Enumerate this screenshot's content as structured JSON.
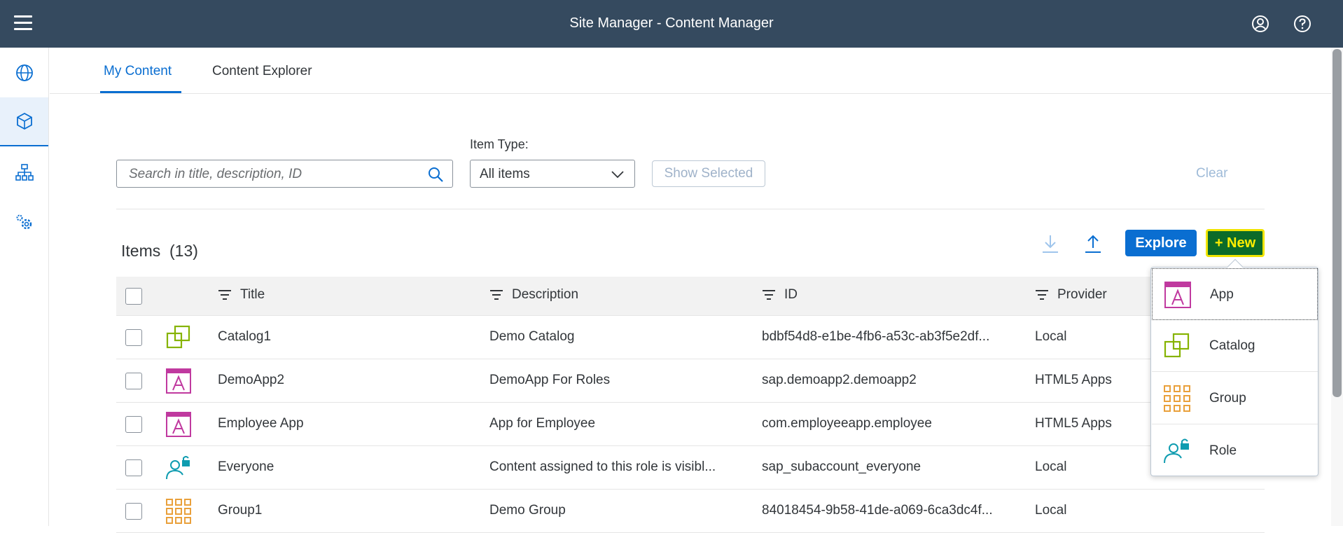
{
  "header": {
    "title": "Site Manager - Content Manager"
  },
  "tabs": [
    {
      "label": "My Content"
    },
    {
      "label": "Content Explorer"
    }
  ],
  "filters": {
    "item_type_label": "Item Type:",
    "search_placeholder": "Search in title, description, ID",
    "item_type_value": "All items",
    "show_selected_label": "Show Selected",
    "clear_label": "Clear"
  },
  "items": {
    "title": "Items",
    "count": "(13)",
    "explore_label": "Explore",
    "new_label": "+ New"
  },
  "table": {
    "columns": [
      "Title",
      "Description",
      "ID",
      "Provider"
    ],
    "rows": [
      {
        "icon": "catalog-icon",
        "title": "Catalog1",
        "description": "Demo Catalog",
        "id": "bdbf54d8-e1be-4fb6-a53c-ab3f5e2df...",
        "provider": "Local"
      },
      {
        "icon": "app-icon",
        "title": "DemoApp2",
        "description": "DemoApp For Roles",
        "id": "sap.demoapp2.demoapp2",
        "provider": "HTML5 Apps"
      },
      {
        "icon": "app-icon",
        "title": "Employee App",
        "description": "App for Employee",
        "id": "com.employeeapp.employee",
        "provider": "HTML5 Apps"
      },
      {
        "icon": "role-icon",
        "title": "Everyone",
        "description": "Content assigned to this role is visibl...",
        "id": "sap_subaccount_everyone",
        "provider": "Local"
      },
      {
        "icon": "group-icon",
        "title": "Group1",
        "description": "Demo Group",
        "id": "84018454-9b58-41de-a069-6ca3dc4f...",
        "provider": "Local"
      }
    ]
  },
  "new_menu": {
    "items": [
      {
        "icon": "app-icon",
        "label": "App"
      },
      {
        "icon": "catalog-icon",
        "label": "Catalog"
      },
      {
        "icon": "group-icon",
        "label": "Group"
      },
      {
        "icon": "role-icon",
        "label": "Role"
      }
    ]
  },
  "colors": {
    "shell": "#354a5f",
    "accent": "#0a6ed1",
    "new_button_bg": "#0c6b29",
    "new_button_text": "#ffee00",
    "app_icon": "#c0399f",
    "catalog_icon": "#86b300",
    "group_icon": "#e9a03b",
    "role_icon": "#0f9cb0"
  }
}
